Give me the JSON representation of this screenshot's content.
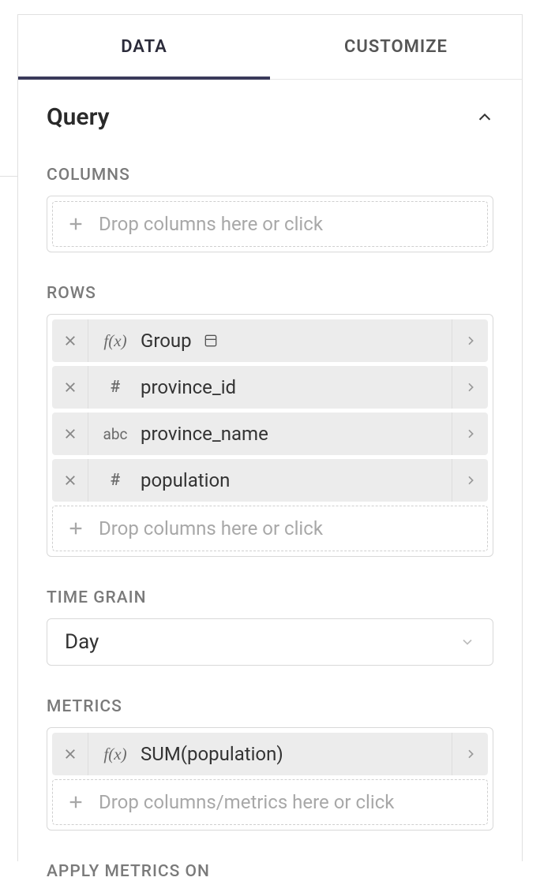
{
  "tabs": {
    "data": "DATA",
    "customize": "CUSTOMIZE"
  },
  "section": {
    "title": "Query"
  },
  "columns": {
    "label": "COLUMNS",
    "placeholder": "Drop columns here or click"
  },
  "rows": {
    "label": "ROWS",
    "items": [
      {
        "type": "fx",
        "label": "Group",
        "extra_icon": true
      },
      {
        "type": "num",
        "label": "province_id",
        "extra_icon": false
      },
      {
        "type": "abc",
        "label": "province_name",
        "extra_icon": false
      },
      {
        "type": "num",
        "label": "population",
        "extra_icon": false
      }
    ],
    "placeholder": "Drop columns here or click"
  },
  "time_grain": {
    "label": "TIME GRAIN",
    "value": "Day"
  },
  "metrics": {
    "label": "METRICS",
    "items": [
      {
        "type": "fx",
        "label": "SUM(population)"
      }
    ],
    "placeholder": "Drop columns/metrics here or click"
  },
  "apply_metrics": {
    "label": "APPLY METRICS ON"
  }
}
